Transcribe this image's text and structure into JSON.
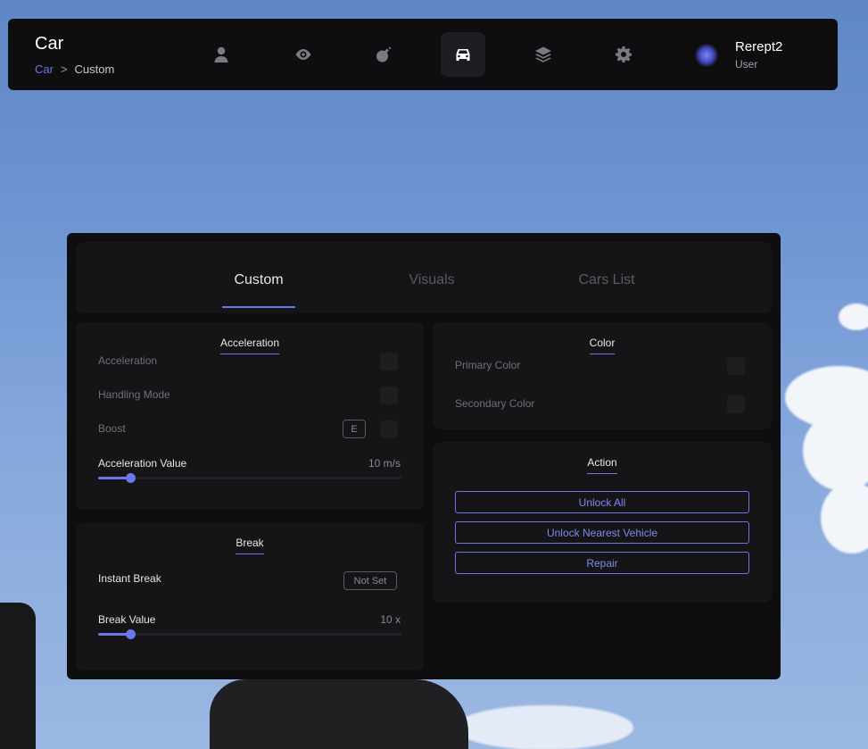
{
  "header": {
    "title": "Car",
    "breadcrumb": {
      "root": "Car",
      "separator": ">",
      "current": "Custom"
    },
    "nav_icons": [
      "user-icon",
      "eye-icon",
      "bomb-icon",
      "car-icon",
      "layers-icon",
      "gear-icon"
    ],
    "active_nav": "car-icon",
    "user": {
      "name": "Rerept2",
      "role": "User"
    }
  },
  "tabs": [
    {
      "label": "Custom",
      "active": true
    },
    {
      "label": "Visuals",
      "active": false
    },
    {
      "label": "Cars List",
      "active": false
    }
  ],
  "acceleration": {
    "title": "Acceleration",
    "rows": [
      {
        "label": "Acceleration",
        "checked": false
      },
      {
        "label": "Handling Mode",
        "checked": false
      },
      {
        "label": "Boost",
        "key": "E",
        "checked": false
      }
    ],
    "slider": {
      "label": "Acceleration Value",
      "value": "10 m/s",
      "fraction": 0.1
    }
  },
  "brake": {
    "title": "Break",
    "instant_label": "Instant Break",
    "instant_key": "Not Set",
    "slider": {
      "label": "Break Value",
      "value": "10 x",
      "fraction": 0.1
    }
  },
  "color": {
    "title": "Color",
    "rows": [
      {
        "label": "Primary Color",
        "checked": false
      },
      {
        "label": "Secondary Color",
        "checked": false
      }
    ]
  },
  "action": {
    "title": "Action",
    "buttons": [
      "Unlock All",
      "Unlock Nearest Vehicle",
      "Repair"
    ]
  },
  "colors": {
    "accent": "#6b76e8",
    "panel": "#0e0e10",
    "card": "#151517"
  }
}
